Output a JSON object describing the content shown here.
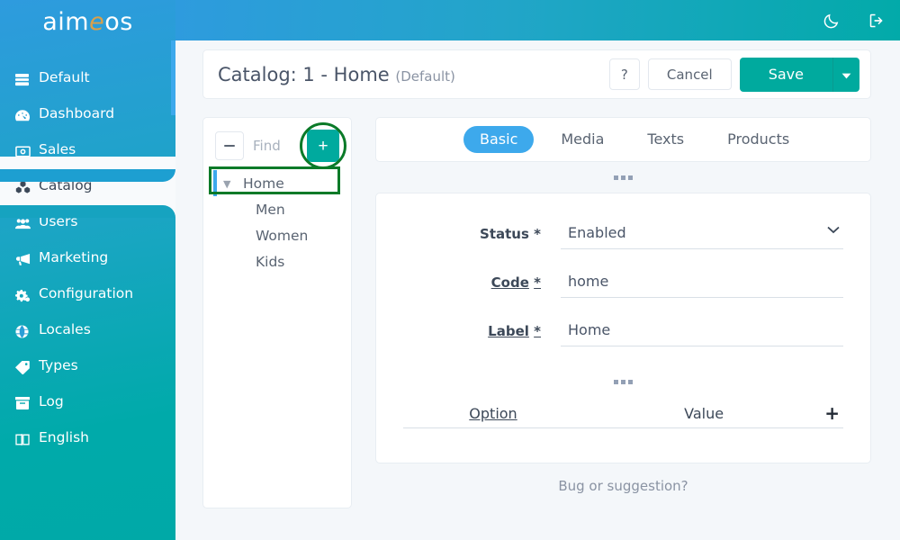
{
  "brand": {
    "name_prefix": "aim",
    "name_accent": "e",
    "name_suffix": "os"
  },
  "colors": {
    "sidebar_top": "#2e9bde",
    "sidebar_bottom": "#00aaaa",
    "accent_teal": "#00aa9e",
    "accent_blue": "#3da9ec",
    "highlight_green": "#0a7a28"
  },
  "topbar": {
    "dark_mode_icon": "moon-icon",
    "logout_icon": "logout-icon"
  },
  "sidebar": {
    "items": [
      {
        "label": "Default",
        "icon": "server-icon",
        "active": false
      },
      {
        "label": "Dashboard",
        "icon": "gauge-icon",
        "active": false
      },
      {
        "label": "Sales",
        "icon": "money-icon",
        "active": false
      },
      {
        "label": "Catalog",
        "icon": "cubes-icon",
        "active": true
      },
      {
        "label": "Users",
        "icon": "users-icon",
        "active": false
      },
      {
        "label": "Marketing",
        "icon": "bullhorn-icon",
        "active": false
      },
      {
        "label": "Configuration",
        "icon": "cogs-icon",
        "active": false
      },
      {
        "label": "Locales",
        "icon": "globe-icon",
        "active": false
      },
      {
        "label": "Types",
        "icon": "tag-icon",
        "active": false
      },
      {
        "label": "Log",
        "icon": "archive-icon",
        "active": false
      },
      {
        "label": "English",
        "icon": "language-icon",
        "active": false
      }
    ]
  },
  "header": {
    "title": "Catalog: 1 - Home",
    "subtitle": "(Default)",
    "help_label": "?",
    "cancel_label": "Cancel",
    "save_label": "Save",
    "save_caret_icon": "chevron-down-icon"
  },
  "tree": {
    "collapse_icon": "minus-icon",
    "find_placeholder": "Find",
    "find_value": "",
    "add_label": "+",
    "add_highlighted": true,
    "nodes": [
      {
        "label": "Home",
        "level": 0,
        "expanded": true,
        "selected": true,
        "caret": "▼"
      },
      {
        "label": "Men",
        "level": 1,
        "expanded": false,
        "selected": false,
        "caret": ""
      },
      {
        "label": "Women",
        "level": 1,
        "expanded": false,
        "selected": false,
        "caret": ""
      },
      {
        "label": "Kids",
        "level": 1,
        "expanded": false,
        "selected": false,
        "caret": ""
      }
    ]
  },
  "tabs": [
    {
      "label": "Basic",
      "active": true
    },
    {
      "label": "Media",
      "active": false
    },
    {
      "label": "Texts",
      "active": false
    },
    {
      "label": "Products",
      "active": false
    }
  ],
  "form": {
    "fields": [
      {
        "label": "Status",
        "required": "*",
        "underlined": false,
        "type": "select",
        "value": "Enabled",
        "caret_icon": "chevron-down-icon"
      },
      {
        "label": "Code",
        "required": "*",
        "underlined": true,
        "type": "text",
        "value": "home",
        "placeholder": ""
      },
      {
        "label": "Label",
        "required": "*",
        "underlined": true,
        "type": "text",
        "value": "Home",
        "placeholder": ""
      }
    ],
    "options_table": {
      "col_option": "Option",
      "col_value": "Value",
      "add_label": "+",
      "rows": []
    }
  },
  "footer": {
    "bug_text": "Bug or suggestion?"
  }
}
